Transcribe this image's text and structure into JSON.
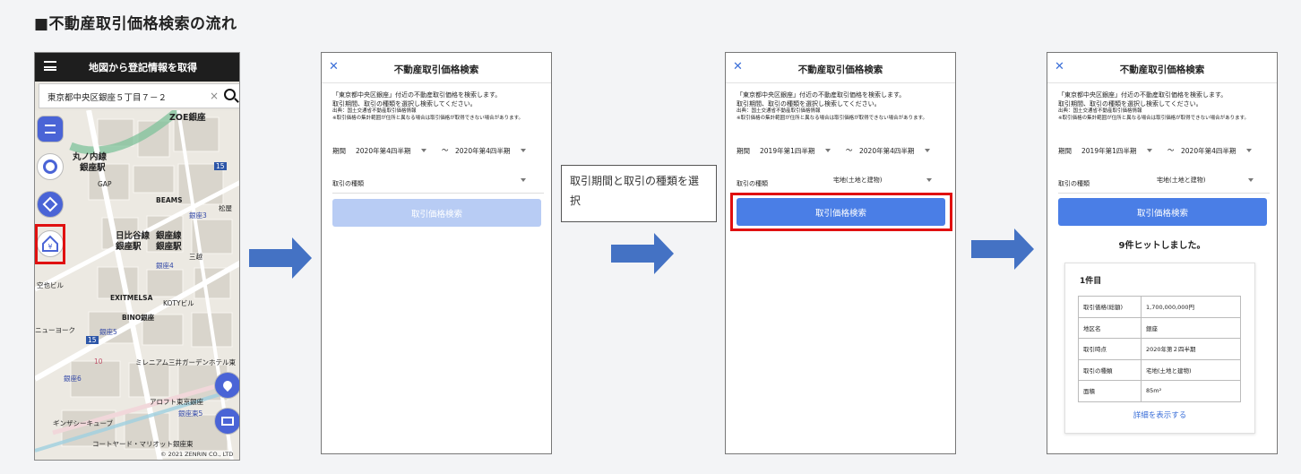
{
  "page_title": "■不動産取引価格検索の流れ",
  "map_screen": {
    "header_title": "地図から登記情報を取得",
    "search_value": "東京都中央区銀座５丁目７－２",
    "clear_symbol": "×",
    "labels": {
      "zoe": "ZOE銀座",
      "marunouchi": "丸ノ内線",
      "ginza_st_1": "銀座駅",
      "gap": "GAP",
      "beams": "BEAMS",
      "ginza3": "銀座3",
      "matsuya": "松屋",
      "hibiya": "日比谷線",
      "ginzasen": "銀座線",
      "ginza_st_2": "銀座駅",
      "ginza_st_3": "銀座駅",
      "ginza4": "銀座4",
      "mitsukoshi": "三越",
      "sorairu": "空也ビル",
      "exitmelsa": "EXITMELSA",
      "kotoya": "KOTYビル",
      "bino": "BINO銀座",
      "newyork": "ニューヨーク",
      "ginza5": "銀座5",
      "mileniam": "ミレニアム三井ガーデンホテル東",
      "ginza6": "銀座6",
      "aroft": "アロフト東京銀座",
      "ginza7": "銀座東5",
      "ginzacube": "ギンザシーキューブ",
      "courtyard": "コートヤード・マリオット銀座東",
      "route15a": "15",
      "route15b": "15",
      "tick10": "10"
    },
    "copyright": "© 2021 ZENRIN CO., LTD"
  },
  "step1": {
    "title": "不動産取引価格検索",
    "desc_line1": "「東京都中央区銀座」付近の不動産取引価格を検索します。",
    "desc_line2": "取引期間、取引の種類を選択し検索してください。",
    "desc_source": "出典：国土交通省不動産取引価格情報",
    "desc_note": "※取引価格の集計範囲が住所と異なる場合は取引価格が取得できない場合があります。",
    "period_label": "期間",
    "period_from": "2020年第4四半期",
    "tilde": "〜",
    "period_to": "2020年第4四半期",
    "type_label": "取引の種類",
    "type_value": "",
    "button": "取引価格検索"
  },
  "instruction": "取引期間と取引の種類を選択",
  "step2": {
    "title": "不動産取引価格検索",
    "desc_line1": "「東京都中央区銀座」付近の不動産取引価格を検索します。",
    "desc_line2": "取引期間、取引の種類を選択し検索してください。",
    "desc_source": "出典：国土交通省不動産取引価格情報",
    "desc_note": "※取引価格の集計範囲が住所と異なる場合は取引価格が取得できない場合があります。",
    "period_label": "期間",
    "period_from": "2019年第1四半期",
    "tilde": "〜",
    "period_to": "2020年第4四半期",
    "type_label": "取引の種類",
    "type_value": "宅地(土地と建物)",
    "button": "取引価格検索"
  },
  "step3": {
    "title": "不動産取引価格検索",
    "desc_line1": "「東京都中央区銀座」付近の不動産取引価格を検索します。",
    "desc_line2": "取引期間、取引の種類を選択し検索してください。",
    "desc_source": "出典：国土交通省不動産取引価格情報",
    "desc_note": "※取引価格の集計範囲が住所と異なる場合は取引価格が取得できない場合があります。",
    "period_label": "期間",
    "period_from": "2019年第1四半期",
    "tilde": "〜",
    "period_to": "2020年第4四半期",
    "type_label": "取引の種類",
    "type_value": "宅地(土地と建物)",
    "button": "取引価格検索",
    "hit_count": "9件ヒットしました。",
    "card_title": "1件目",
    "rows": [
      {
        "label": "取引価格(総額)",
        "value": "1,700,000,000円"
      },
      {
        "label": "地区名",
        "value": "銀座"
      },
      {
        "label": "取引時点",
        "value": "2020年第２四半期"
      },
      {
        "label": "取引の種類",
        "value": "宅地(土地と建物)"
      },
      {
        "label": "面積",
        "value": "85m²"
      }
    ],
    "detail_link": "詳細を表示する"
  },
  "colors": {
    "accent": "#4a7ee6",
    "accent_disabled": "#b8ccf4",
    "highlight": "#e01010",
    "arrow": "#4472c4"
  }
}
